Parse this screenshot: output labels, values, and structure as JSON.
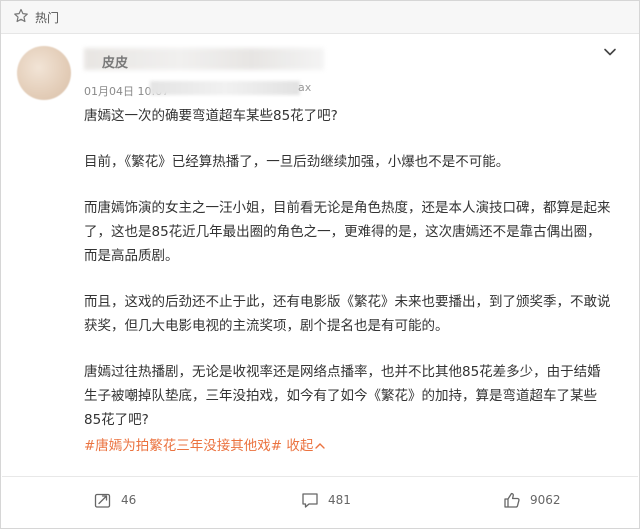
{
  "header": {
    "title": "热门",
    "icon": "star-outline-icon"
  },
  "post": {
    "author_visible": "皮皮",
    "meta_prefix": "01月04日 10:07",
    "meta_suffix": "ax",
    "paragraphs": [
      "唐嫣这一次的确要弯道超车某些85花了吧?",
      "目前，《繁花》已经算热播了，一旦后劲继续加强，小爆也不是不可能。",
      "而唐嫣饰演的女主之一汪小姐，目前看无论是角色热度，还是本人演技口碑，都算是起来了，这也是85花近几年最出圈的角色之一，更难得的是，这次唐嫣还不是靠古偶出圈，而是高品质剧。",
      "而且，这戏的后劲还不止于此，还有电影版《繁花》未来也要播出，到了颁奖季，不敢说获奖，但几大电影电视的主流奖项，剧个提名也是有可能的。",
      "唐嫣过往热播剧，无论是收视率还是网络点播率，也并不比其他85花差多少，由于结婚生子被嘲掉队垫底，三年没拍戏，如今有了如今《繁花》的加持，算是弯道超车了某些85花了吧?"
    ],
    "hashtag": "#唐嫣为拍繁花三年没接其他戏#",
    "collapse_label": "收起",
    "accent_color": "#eb7340"
  },
  "actions": {
    "repost_count": "46",
    "comment_count": "481",
    "like_count": "9062"
  }
}
